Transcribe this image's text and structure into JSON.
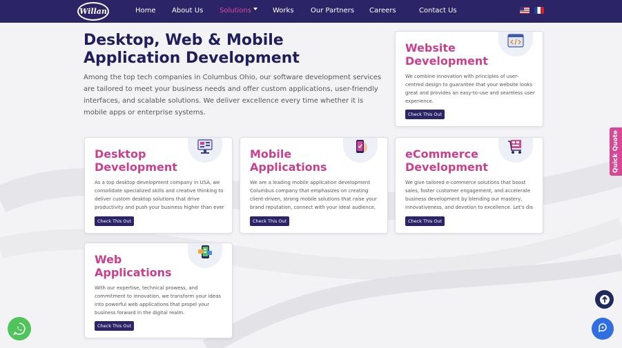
{
  "nav": {
    "logo_text": "Willan",
    "items": [
      "Home",
      "About Us",
      "Solutions",
      "Works",
      "Our Partners",
      "Careers",
      "Contact Us"
    ],
    "flags": [
      "us-flag-icon",
      "fr-flag-icon"
    ]
  },
  "hero": {
    "title": "Desktop, Web & Mobile Application Development",
    "text": "Among the top tech companies in Columbus Ohio, our software development services are tailored to meet your business needs and offer custom applications, user-friendly interfaces, and scalable solutions. We deliver excellence every time whether it is mobile apps or enterprise systems."
  },
  "cards": [
    {
      "title": "Website Development",
      "desc": "We combine innovation with principles of user-centred design to guarantee that your website looks great and provides an easy-to-use and seamless user experience.",
      "button": "Check This Out",
      "icon": "code-window-icon"
    },
    {
      "title": "Desktop Development",
      "desc": "As a top desktop development company in USA, we consolidate specialized skills and creative thinking to deliver custom desktop solutions that drive productivity and push your business higher than ever",
      "button": "Check This Out",
      "icon": "desktop-monitor-icon"
    },
    {
      "title": "Mobile Applications",
      "desc": "We are a leading mobile application development Columbus company that emphasizes on creating client-driven, strong mobile solutions that raise your brand reputation, connect with your ideal audience,",
      "button": "Check This Out",
      "icon": "mobile-phone-icon"
    },
    {
      "title": "eCommerce Development",
      "desc": "We give tailored e-commerce solutions that boost sales, foster customer engagement, and accelerate business development by blending our mastery, innovativeness, and devotion to excellence. Let's dis",
      "button": "Check This Out",
      "icon": "shopping-cart-icon"
    },
    {
      "title": "Web Applications",
      "desc": "With our expertise, technical prowess, and commitment to innovation, we transform your ideas into powerful web applications that propel your business forward in the digital realm.",
      "button": "Check This Out",
      "icon": "web-app-icon"
    }
  ],
  "floats": {
    "quick_quote": "Quick Quote"
  },
  "colors": {
    "navbar": "#2b2567",
    "accent_pink": "#c8408f",
    "button": "#2b2567"
  }
}
